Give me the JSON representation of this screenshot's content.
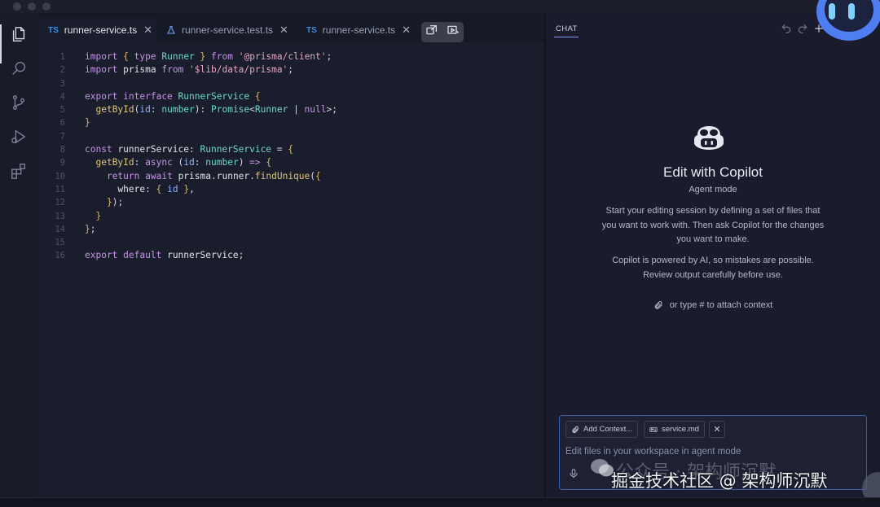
{
  "window": {
    "traffic_lights": [
      "close",
      "minimize",
      "zoom"
    ]
  },
  "activity_bar": {
    "items": [
      {
        "name": "explorer-icon",
        "active": true
      },
      {
        "name": "search-icon",
        "active": false
      },
      {
        "name": "source-control-icon",
        "active": false
      },
      {
        "name": "run-debug-icon",
        "active": false
      },
      {
        "name": "extensions-icon",
        "active": false
      }
    ]
  },
  "tabs": [
    {
      "label": "runner-service.ts",
      "badge": "TS",
      "active": true,
      "close": "✕"
    },
    {
      "label": "runner-service.test.ts",
      "badge": "",
      "icon": "flask-icon",
      "active": false,
      "close": "✕"
    },
    {
      "label": "runner-service.ts",
      "badge": "TS",
      "active": false,
      "close": "✕"
    }
  ],
  "editor": {
    "line_numbers": [
      "1",
      "2",
      "3",
      "4",
      "5",
      "6",
      "7",
      "8",
      "9",
      "10",
      "11",
      "12",
      "13",
      "14",
      "15",
      "16"
    ],
    "code": [
      "import { type Runner } from '@prisma/client';",
      "import prisma from '$lib/data/prisma';",
      "",
      "export interface RunnerService {",
      "  getById(id: number): Promise<Runner | null>;",
      "}",
      "",
      "const runnerService: RunnerService = {",
      "  getById: async (id: number) => {",
      "    return await prisma.runner.findUnique({",
      "      where: { id },",
      "    });",
      "  }",
      "};",
      "",
      "export default runnerService;"
    ]
  },
  "chat": {
    "tab_label": "CHAT",
    "title": "Edit with Copilot",
    "mode": "Agent mode",
    "intro": "Start your editing session by defining a set of files that you want to work with. Then ask Copilot for the changes you want to make.",
    "disclaimer": "Copilot is powered by AI, so mistakes are possible. Review output carefully before use.",
    "attach_hint": "or type # to attach context",
    "add_context_label": "Add Context...",
    "file_chip_label": "service.md",
    "chip_remove": "✕",
    "input_placeholder": "Edit files in your workspace in agent mode"
  },
  "watermark": {
    "line1": "公众号 · 架构师沉默",
    "line2": "掘金技术社区 @ 架构师沉默"
  },
  "colors": {
    "accent": "#3b5fae",
    "ts_badge": "#3b8eea",
    "keyword": "#c792ea",
    "type": "#6ed8c8",
    "string": "#e5a5c8"
  }
}
